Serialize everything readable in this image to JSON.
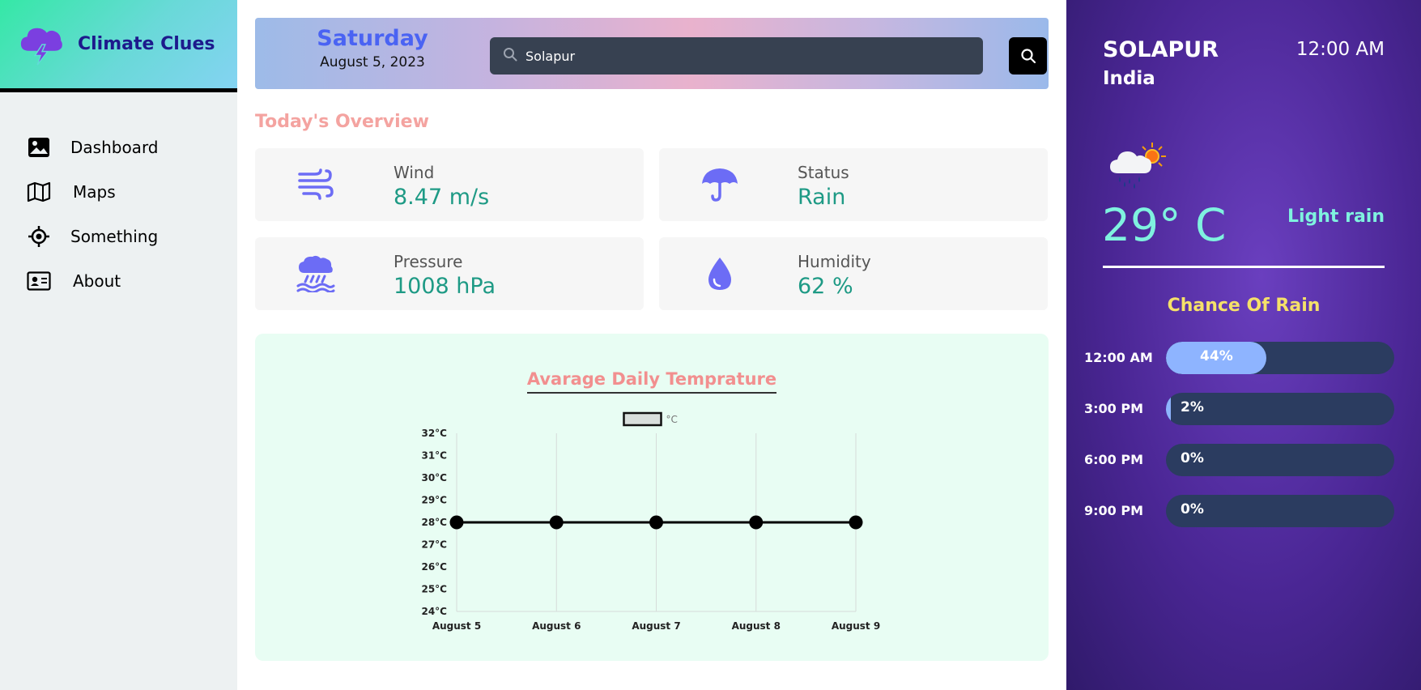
{
  "app": {
    "name": "Climate Clues"
  },
  "sidebar": {
    "items": [
      {
        "label": "Dashboard",
        "icon": "image-icon"
      },
      {
        "label": "Maps",
        "icon": "map-icon"
      },
      {
        "label": "Something",
        "icon": "crosshair-icon"
      },
      {
        "label": "About",
        "icon": "id-card-icon"
      }
    ]
  },
  "header": {
    "day": "Saturday",
    "date": "August 5, 2023",
    "search": {
      "value": "Solapur",
      "placeholder": ""
    }
  },
  "overview": {
    "title": "Today's Overview",
    "cards": [
      {
        "label": "Wind",
        "value": "8.47 m/s",
        "icon": "wind-icon"
      },
      {
        "label": "Status",
        "value": "Rain",
        "icon": "umbrella-icon"
      },
      {
        "label": "Pressure",
        "value": "1008 hPa",
        "icon": "cloud-rain-icon"
      },
      {
        "label": "Humidity",
        "value": "62 %",
        "icon": "droplet-icon"
      }
    ]
  },
  "chart_data": {
    "type": "line",
    "title": "Avarage Daily Temprature",
    "categories": [
      "August 5",
      "August 6",
      "August 7",
      "August 8",
      "August 9"
    ],
    "series": [
      {
        "name": "°C",
        "values": [
          28,
          28,
          28,
          28,
          28
        ]
      }
    ],
    "yticks": [
      "32°C",
      "31°C",
      "30°C",
      "29°C",
      "28°C",
      "27°C",
      "26°C",
      "25°C",
      "24°C"
    ],
    "ylim": [
      24,
      32
    ],
    "grid": "vertical",
    "legend": "top"
  },
  "current": {
    "city": "SOLAPUR",
    "country": "India",
    "time": "12:00 AM",
    "temperature": "29° C",
    "condition": "Light rain",
    "icon": "rain-sun-icon"
  },
  "chance_of_rain": {
    "title": "Chance Of Rain",
    "rows": [
      {
        "time": "12:00 AM",
        "percent": 44,
        "label": "44%"
      },
      {
        "time": "3:00 PM",
        "percent": 2,
        "label": "2%"
      },
      {
        "time": "6:00 PM",
        "percent": 0,
        "label": "0%"
      },
      {
        "time": "9:00 PM",
        "percent": 0,
        "label": "0%"
      }
    ]
  },
  "colors": {
    "accent": "#4a63f3",
    "icon": "#6c6cf5",
    "value": "#1e9a85",
    "rain_fill": "#8eb4ff"
  }
}
